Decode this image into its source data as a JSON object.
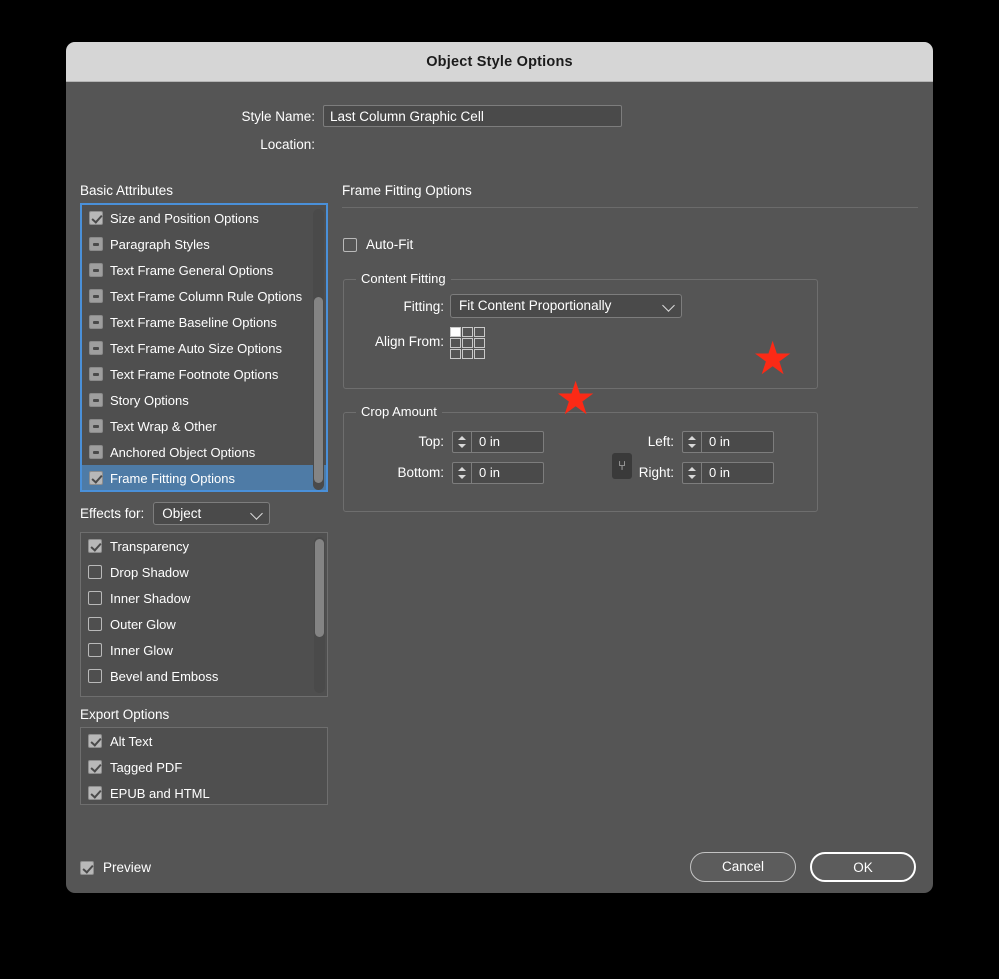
{
  "window": {
    "title": "Object Style Options"
  },
  "style_name": {
    "label": "Style Name:",
    "value": "Last Column Graphic Cell"
  },
  "location": {
    "label": "Location:",
    "value": ""
  },
  "basic_attributes": {
    "title": "Basic Attributes",
    "items": [
      {
        "label": "Size and Position Options",
        "state": "checked",
        "selected": false
      },
      {
        "label": "Paragraph Styles",
        "state": "dash",
        "selected": false
      },
      {
        "label": "Text Frame General Options",
        "state": "dash",
        "selected": false
      },
      {
        "label": "Text Frame Column Rule Options",
        "state": "dash",
        "selected": false
      },
      {
        "label": "Text Frame Baseline Options",
        "state": "dash",
        "selected": false
      },
      {
        "label": "Text Frame Auto Size Options",
        "state": "dash",
        "selected": false
      },
      {
        "label": "Text Frame Footnote Options",
        "state": "dash",
        "selected": false
      },
      {
        "label": "Story Options",
        "state": "dash",
        "selected": false
      },
      {
        "label": "Text Wrap & Other",
        "state": "dash",
        "selected": false
      },
      {
        "label": "Anchored Object Options",
        "state": "dash",
        "selected": false
      },
      {
        "label": "Frame Fitting Options",
        "state": "checked",
        "selected": true
      }
    ]
  },
  "effects": {
    "label": "Effects for:",
    "selected_target": "Object",
    "items": [
      {
        "label": "Transparency",
        "state": "checked"
      },
      {
        "label": "Drop Shadow",
        "state": "empty"
      },
      {
        "label": "Inner Shadow",
        "state": "empty"
      },
      {
        "label": "Outer Glow",
        "state": "empty"
      },
      {
        "label": "Inner Glow",
        "state": "empty"
      },
      {
        "label": "Bevel and Emboss",
        "state": "empty"
      }
    ]
  },
  "export_options": {
    "title": "Export Options",
    "items": [
      {
        "label": "Alt Text",
        "state": "checked"
      },
      {
        "label": "Tagged PDF",
        "state": "checked"
      },
      {
        "label": "EPUB and HTML",
        "state": "checked"
      }
    ]
  },
  "panel": {
    "title": "Frame Fitting Options",
    "auto_fit": {
      "label": "Auto-Fit",
      "state": "empty"
    },
    "content_fitting": {
      "legend": "Content Fitting",
      "fitting_label": "Fitting:",
      "fitting_value": "Fit Content Proportionally",
      "align_from_label": "Align From:",
      "align_from_anchor": "top-left"
    },
    "crop_amount": {
      "legend": "Crop Amount",
      "top_label": "Top:",
      "top_value": "0 in",
      "bottom_label": "Bottom:",
      "bottom_value": "0 in",
      "left_label": "Left:",
      "left_value": "0 in",
      "right_label": "Right:",
      "right_value": "0 in",
      "link_glyph": "⑂"
    }
  },
  "annotations": {
    "star_glyph": "★",
    "star_color": "#fb2a16",
    "count": 2
  },
  "footer": {
    "preview_label": "Preview",
    "preview_state": "checked",
    "cancel_label": "Cancel",
    "ok_label": "OK"
  },
  "colors": {
    "dialog_bg": "#555555",
    "titlebar_bg": "#d6d6d6",
    "list_bg": "#4f4f4f",
    "selection_blue": "#4e7ba6",
    "focus_border": "#4a90d9",
    "accent_red": "#fb2a16"
  }
}
